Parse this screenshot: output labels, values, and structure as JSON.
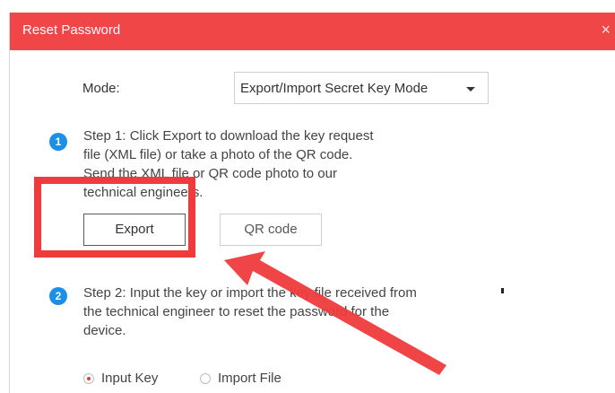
{
  "dialog": {
    "title": "Reset Password",
    "close_symbol": "×"
  },
  "mode": {
    "label": "Mode:",
    "selected": "Export/Import Secret Key Mode"
  },
  "step1": {
    "badge": "1",
    "text": "Step 1: Click Export to download the key request file (XML file) or take a photo of the QR code. Send the XML file or QR code photo to our technical engineers."
  },
  "buttons": {
    "export": "Export",
    "qr": "QR code"
  },
  "step2": {
    "badge": "2",
    "text": "Step 2: Input the key or import the key file received from the technical engineer to reset the password for the device."
  },
  "radios": {
    "input_key": "Input Key",
    "import_file": "Import File"
  },
  "colors": {
    "titlebar": "#f04648",
    "accent_blue": "#1e8fe8",
    "annotation_red": "#ee3b3d"
  }
}
